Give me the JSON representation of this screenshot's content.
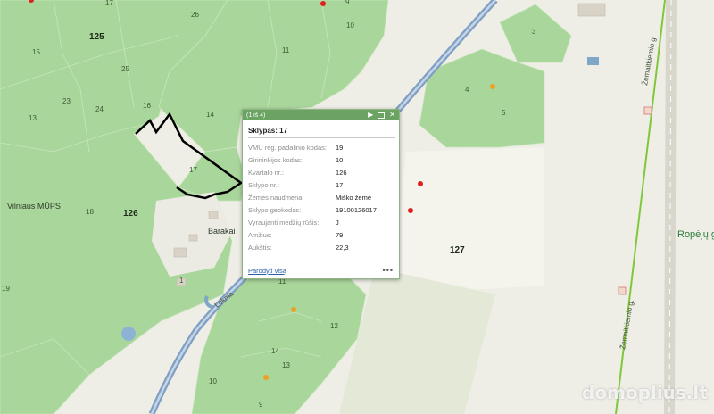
{
  "map": {
    "forest_color": "#a9d69a",
    "open_color": "#efeee6",
    "building_color": "#d9d3c7",
    "road_color": "#7f9fc4",
    "border_line_color": "#7fc83c",
    "selection_color": "#000000",
    "stand_numbers": [
      "17",
      "26",
      "125",
      "15",
      "9",
      "10",
      "25",
      "23",
      "24",
      "13",
      "16",
      "14",
      "11",
      "126",
      "18",
      "17",
      "3",
      "4",
      "5",
      "127",
      "11",
      "12",
      "14",
      "13",
      "10",
      "9",
      "19",
      "1"
    ],
    "quarter_numbers": [
      "125",
      "126",
      "127"
    ],
    "place_names": [
      "Vilniaus MŪPS",
      "Barakai"
    ],
    "road_names": [
      "Lokma",
      "Žemaitkiemio g.",
      "Žemaitkiemio g."
    ],
    "locality_label": "Ropėjų g-ja",
    "markers": [
      {
        "type": "red-point"
      },
      {
        "type": "red-point"
      },
      {
        "type": "red-point"
      },
      {
        "type": "red-point"
      },
      {
        "type": "orange-point"
      },
      {
        "type": "orange-point"
      },
      {
        "type": "orange-point"
      }
    ]
  },
  "popup": {
    "counter": "(1 iš 4)",
    "title": "Sklypas: 17",
    "fields": [
      {
        "label": "VMU reg. padalinio kodas:",
        "value": "19"
      },
      {
        "label": "Girininkijos kodas:",
        "value": "10"
      },
      {
        "label": "Kvartalo nr.:",
        "value": "126"
      },
      {
        "label": "Sklypo nr.:",
        "value": "17"
      },
      {
        "label": "Žemės naudmena:",
        "value": "Miško žemė"
      },
      {
        "label": "Sklypo geokodas:",
        "value": "19100126017"
      },
      {
        "label": "Vyraujanti medžių rūšis:",
        "value": "J"
      },
      {
        "label": "Amžius:",
        "value": "79"
      },
      {
        "label": "Aukštis:",
        "value": "22,3"
      }
    ],
    "show_all": "Parodyti visą",
    "more": "•••"
  },
  "watermark": "domoplius.lt"
}
